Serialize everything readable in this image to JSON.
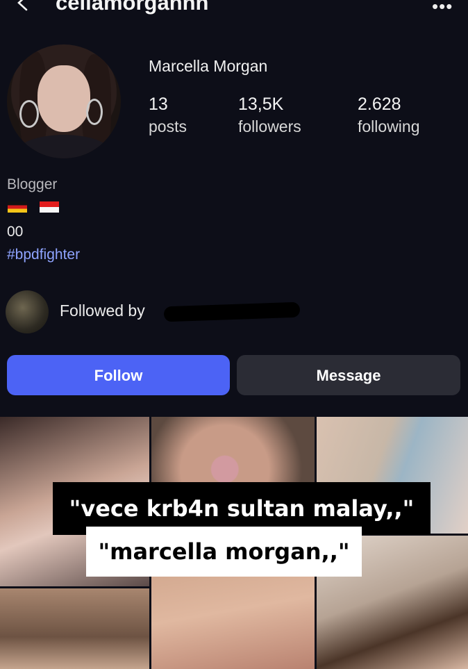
{
  "header": {
    "username": "cellamorgannn",
    "back_icon": "chevron-left-icon",
    "more_icon": "ellipsis-icon",
    "more_glyph": "•••"
  },
  "profile": {
    "full_name": "Marcella Morgan",
    "stats": [
      {
        "value": "13",
        "label": "posts"
      },
      {
        "value": "13,5K",
        "label": "followers"
      },
      {
        "value": "2.628",
        "label": "following"
      }
    ],
    "category": "Blogger",
    "flags": [
      "germany-flag",
      "indonesia-flag"
    ],
    "bio_line": "00",
    "hashtag": "#bpdfighter",
    "followed_by_label": "Followed by"
  },
  "actions": {
    "follow_label": "Follow",
    "message_label": "Message"
  },
  "colors": {
    "background": "#0d0e18",
    "follow_button": "#4c63f5",
    "message_button": "#2b2c35",
    "hashtag": "#8fa4ff"
  },
  "overlay_captions": [
    "\"vece krb4n sultan malay,,\"",
    "\"marcella morgan,,\""
  ]
}
